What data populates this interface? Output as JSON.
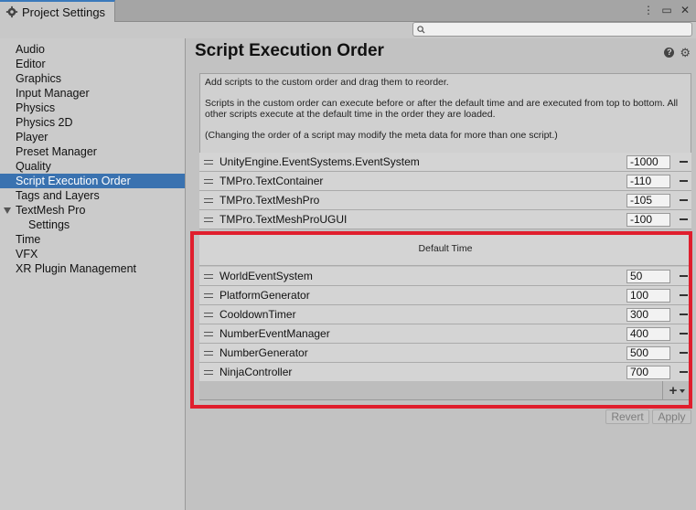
{
  "window": {
    "tab_label": "Project Settings",
    "icons": [
      "more-icon",
      "maximize-icon",
      "close-icon"
    ]
  },
  "search": {
    "placeholder": ""
  },
  "sidebar": {
    "items": [
      {
        "label": "Audio"
      },
      {
        "label": "Editor"
      },
      {
        "label": "Graphics"
      },
      {
        "label": "Input Manager"
      },
      {
        "label": "Physics"
      },
      {
        "label": "Physics 2D"
      },
      {
        "label": "Player"
      },
      {
        "label": "Preset Manager"
      },
      {
        "label": "Quality"
      },
      {
        "label": "Script Execution Order",
        "selected": true
      },
      {
        "label": "Tags and Layers"
      },
      {
        "label": "TextMesh Pro",
        "expanded": true
      },
      {
        "label": "Settings"
      },
      {
        "label": "Time"
      },
      {
        "label": "VFX"
      },
      {
        "label": "XR Plugin Management"
      }
    ]
  },
  "main": {
    "title": "Script Execution Order",
    "help_text": [
      "Add scripts to the custom order and drag them to reorder.",
      "Scripts in the custom order can execute before or after the default time and are executed from top to bottom. All other scripts execute at the default time in the order they are loaded.",
      "(Changing the order of a script may modify the meta data for more than one script.)"
    ],
    "before_default": [
      {
        "name": "UnityEngine.EventSystems.EventSystem",
        "order": "-1000"
      },
      {
        "name": "TMPro.TextContainer",
        "order": "-110"
      },
      {
        "name": "TMPro.TextMeshPro",
        "order": "-105"
      },
      {
        "name": "TMPro.TextMeshProUGUI",
        "order": "-100"
      }
    ],
    "default_time_label": "Default Time",
    "after_default": [
      {
        "name": "WorldEventSystem",
        "order": "50"
      },
      {
        "name": "PlatformGenerator",
        "order": "100"
      },
      {
        "name": "CooldownTimer",
        "order": "300"
      },
      {
        "name": "NumberEventManager",
        "order": "400"
      },
      {
        "name": "NumberGenerator",
        "order": "500"
      },
      {
        "name": "NinjaController",
        "order": "700"
      }
    ],
    "add_button": "+",
    "revert_label": "Revert",
    "apply_label": "Apply",
    "highlight_color": "#e01e2d"
  }
}
